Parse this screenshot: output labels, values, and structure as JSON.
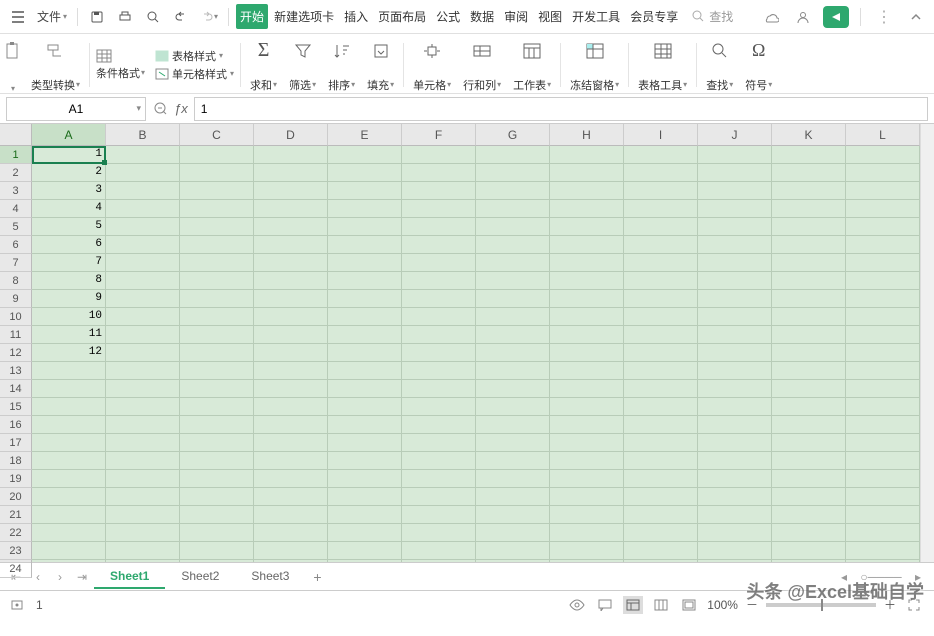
{
  "titlebar": {
    "file_label": "文件",
    "search_placeholder": "查找"
  },
  "menu": {
    "tabs": [
      "开始",
      "新建选项卡",
      "插入",
      "页面布局",
      "公式",
      "数据",
      "审阅",
      "视图",
      "开发工具",
      "会员专享"
    ],
    "active_index": 0
  },
  "ribbon": {
    "type_convert": "类型转换",
    "cond_format": "条件格式",
    "table_style": "表格样式",
    "cell_style": "单元格样式",
    "sum": "求和",
    "filter": "筛选",
    "sort": "排序",
    "fill": "填充",
    "cells": "单元格",
    "row_col": "行和列",
    "worksheet": "工作表",
    "freeze": "冻结窗格",
    "table_tools": "表格工具",
    "find": "查找",
    "symbol": "符号"
  },
  "formula_bar": {
    "name_box": "A1",
    "formula_value": "1"
  },
  "grid": {
    "columns": [
      "A",
      "B",
      "C",
      "D",
      "E",
      "F",
      "G",
      "H",
      "I",
      "J",
      "K",
      "L"
    ],
    "rows": 24,
    "active_col": 0,
    "active_row": 0,
    "data": {
      "A": [
        "1",
        "2",
        "3",
        "4",
        "5",
        "6",
        "7",
        "8",
        "9",
        "10",
        "11",
        "12"
      ]
    }
  },
  "tabs": {
    "sheets": [
      "Sheet1",
      "Sheet2",
      "Sheet3"
    ],
    "active": 0
  },
  "status": {
    "indicator": "1",
    "zoom": "100%"
  },
  "watermark": "头条 @Excel基础自学"
}
